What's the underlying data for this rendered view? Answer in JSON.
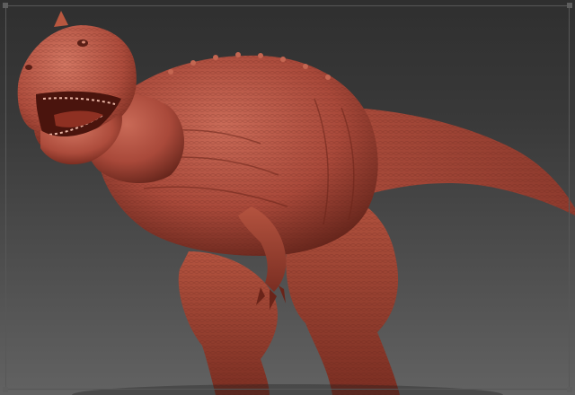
{
  "scene": {
    "subject_icon": "dinosaur-sculpt",
    "colors": {
      "clay": "#a9493a",
      "clay_light": "#c96a57",
      "clay_dark": "#5a1f16",
      "background_top": "#2f2f2f",
      "background_bottom": "#626262",
      "frame": "#575757"
    }
  }
}
